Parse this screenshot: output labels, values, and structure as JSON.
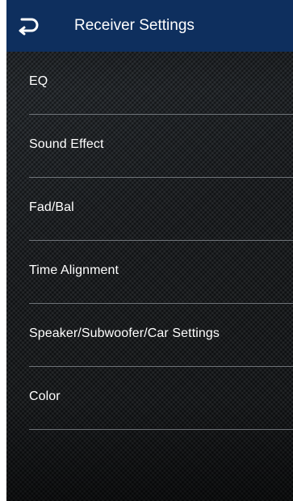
{
  "header": {
    "title": "Receiver Settings",
    "back_icon": "back-arrow-icon",
    "background_color": "#0e2f5e"
  },
  "menu": {
    "items": [
      {
        "label": "EQ"
      },
      {
        "label": "Sound Effect"
      },
      {
        "label": "Fad/Bal"
      },
      {
        "label": "Time Alignment"
      },
      {
        "label": "Speaker/Subwoofer/Car Settings"
      },
      {
        "label": "Color"
      }
    ]
  }
}
